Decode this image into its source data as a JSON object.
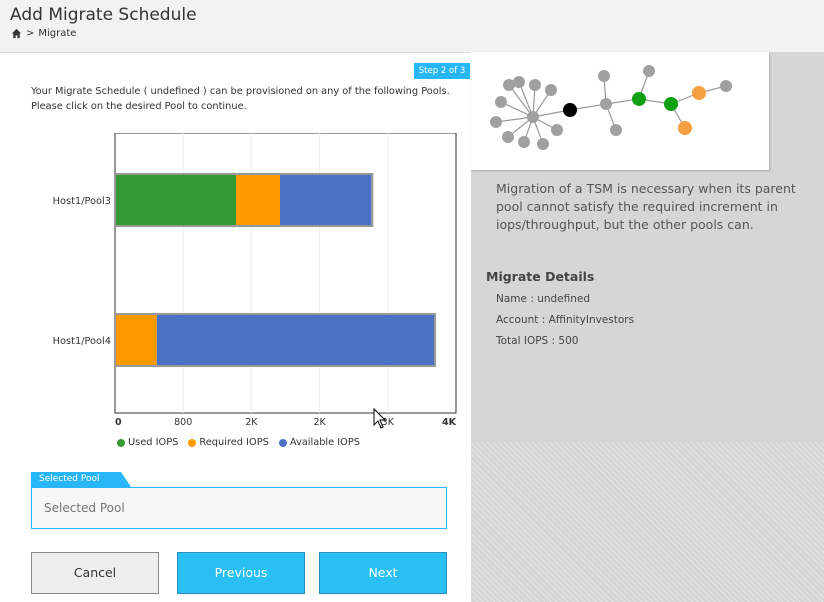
{
  "header": {
    "title": "Add Migrate Schedule",
    "breadcrumb": {
      "separator": ">",
      "current": "Migrate"
    }
  },
  "wizard": {
    "step": "Step 2 of 3",
    "intro_line1": "Your Migrate Schedule ( undefined ) can be provisioned on any of the following Pools.",
    "intro_line2": "Please click on the desired Pool to continue."
  },
  "chart_data": {
    "type": "bar",
    "orientation": "horizontal",
    "stacked": true,
    "categories": [
      "Host1/Pool3",
      "Host1/Pool4"
    ],
    "series": [
      {
        "name": "Used IOPS",
        "color": "#339933",
        "values": [
          1100,
          0
        ]
      },
      {
        "name": "Required IOPS",
        "color": "#ff9900",
        "values": [
          400,
          380
        ]
      },
      {
        "name": "Available IOPS",
        "color": "#4a72c4",
        "values": [
          830,
          2520
        ]
      }
    ],
    "x_tick_labels": [
      "0",
      "800",
      "2K",
      "2K",
      "3K",
      "4K"
    ],
    "xlim": [
      0,
      3100
    ],
    "grid": true,
    "legend": "bottom"
  },
  "selected_pool": {
    "tab_label": "Selected Pool",
    "placeholder": "Selected Pool",
    "value": ""
  },
  "buttons": {
    "cancel": "Cancel",
    "previous": "Previous",
    "next": "Next"
  },
  "info": {
    "description": "Migration of a TSM is necessary when its parent pool cannot satisfy the required increment in iops/throughput, but the other pools can.",
    "details_title": "Migrate Details",
    "name": "Name : undefined",
    "account": "Account : AffinityInvestors",
    "total_iops": "Total IOPS : 500"
  },
  "colors": {
    "accent": "#29b6f6",
    "used": "#339933",
    "required": "#ff9900",
    "available": "#4a72c4"
  }
}
